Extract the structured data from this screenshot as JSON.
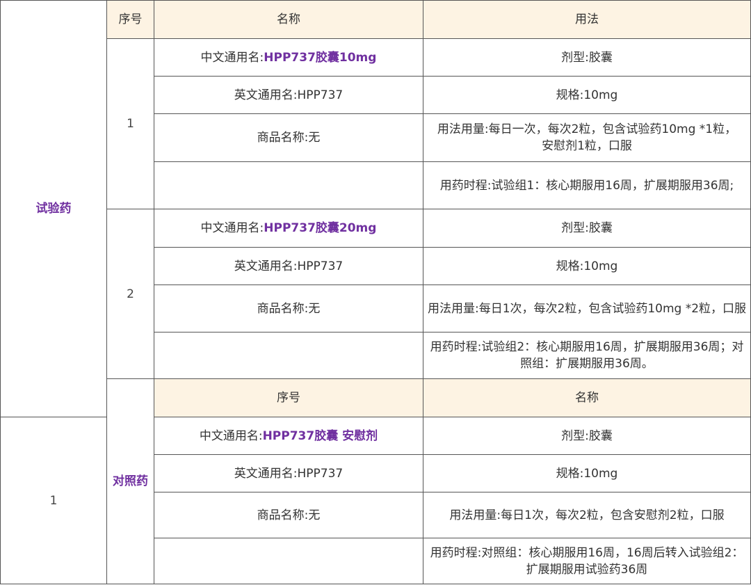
{
  "header": {
    "seq": "序号",
    "name": "名称",
    "usage": "用法"
  },
  "categories": {
    "trial": "试验药",
    "control": "对照药"
  },
  "trial": {
    "g1": {
      "seq": "1",
      "cn_prefix": "中文通用名:",
      "cn_value": "HPP737胶囊10mg",
      "en_name": "英文通用名:HPP737",
      "trade_name": "商品名称:无",
      "dosage_form": "剂型:胶囊",
      "spec": "规格:10mg",
      "dosage": "用法用量:每日一次，每次2粒，包含试验药10mg *1粒，安慰剂1粒，口服",
      "duration": "用药时程:试验组1：核心期服用16周，扩展期服用36周;"
    },
    "g2": {
      "seq": "2",
      "cn_prefix": "中文通用名:",
      "cn_value": "HPP737胶囊20mg",
      "en_name": "英文通用名:HPP737",
      "trade_name": "商品名称:无",
      "dosage_form": "剂型:胶囊",
      "spec": "规格:10mg",
      "dosage": "用法用量:每日1次，每次2粒，包含试验药10mg *2粒，口服",
      "duration": "用药时程:试验组2：核心期服用16周，扩展期服用36周；对照组：扩展期服用36周。"
    }
  },
  "control": {
    "g1": {
      "seq": "1",
      "cn_prefix": "中文通用名:",
      "cn_value": "HPP737胶囊 安慰剂",
      "en_name": "英文通用名:HPP737",
      "trade_name": "商品名称:无",
      "dosage_form": "剂型:胶囊",
      "spec": "规格:10mg",
      "dosage": "用法用量:每日1次，每次2粒，包含安慰剂2粒，口服",
      "duration": "用药时程:对照组：核心期服用16周，16周后转入试验组2：扩展期服用试验药36周"
    }
  },
  "colors": {
    "accent": "#7030a0",
    "header_bg": "#fdf3e3",
    "border": "#555555"
  }
}
